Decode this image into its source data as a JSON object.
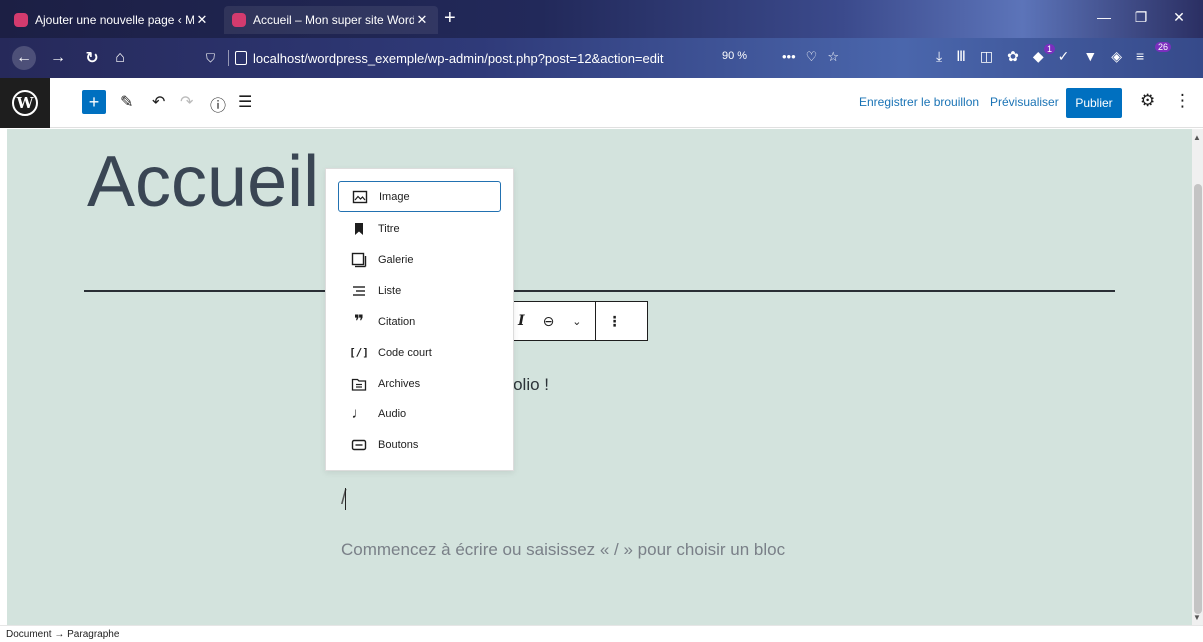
{
  "browser": {
    "tabs": [
      {
        "title": "Ajouter une nouvelle page ‹ M"
      },
      {
        "title": "Accueil – Mon super site Word"
      }
    ],
    "url": "localhost/wordpress_exemple/wp-admin/post.php?post=12&action=edit",
    "zoom": "90 %",
    "badges": {
      "notif": "1",
      "ext": "26"
    }
  },
  "wp": {
    "header": {
      "save_draft": "Enregistrer le brouillon",
      "preview": "Prévisualiser",
      "publish": "Publier"
    },
    "content": {
      "heading": "Accueil",
      "paragraph_visible": "rtfolio !",
      "slash_input": "/",
      "placeholder": "Commencez à écrire ou saisissez « / » pour choisir un bloc"
    },
    "inserter": {
      "items": [
        {
          "label": "Image",
          "icon": "image-icon"
        },
        {
          "label": "Titre",
          "icon": "bookmark-icon"
        },
        {
          "label": "Galerie",
          "icon": "gallery-icon"
        },
        {
          "label": "Liste",
          "icon": "list-icon"
        },
        {
          "label": "Citation",
          "icon": "quote-icon"
        },
        {
          "label": "Code court",
          "icon": "shortcode-icon"
        },
        {
          "label": "Archives",
          "icon": "archive-icon"
        },
        {
          "label": "Audio",
          "icon": "audio-icon"
        },
        {
          "label": "Boutons",
          "icon": "buttons-icon"
        }
      ]
    },
    "breadcrumb": "Document → Paragraphe"
  },
  "colors": {
    "canvas": "#d3e3dd",
    "accent": "#0070c0",
    "wp_dark": "#1e1e1e"
  }
}
